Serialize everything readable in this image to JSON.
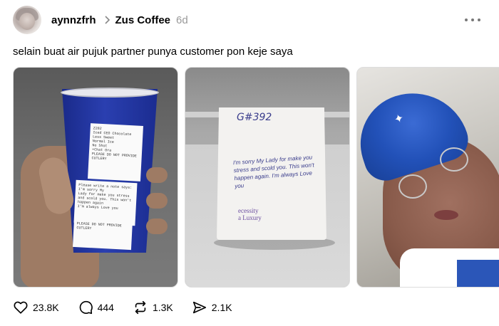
{
  "post": {
    "username": "aynnzfrh",
    "community": "Zus Coffee",
    "time_ago": "6d",
    "text": "selain buat air pujuk partner punya customer pon keje saya"
  },
  "images": {
    "cup": {
      "label1": [
        "Z282",
        "Iced CEO Chocolate",
        "Less Sweet",
        "Normal Ice",
        "No Shot",
        "+Chat Ora",
        "",
        "PLEASE DO NOT PROVIDE",
        "CUTLERY"
      ],
      "label2": [
        "Please write a note says: I'm sorry My",
        "Lady for make you stress",
        "and scold you. This won't happen again",
        "I'm always Love you"
      ],
      "label3": [
        "PLEASE DO NOT PROVIDE",
        "CUTLERY"
      ]
    },
    "bag": {
      "order_code": "G#392",
      "note": "I'm sorry My Lady for make you stress and scold you. This won't happen again. I'm always Love you",
      "brand_line1": "ecessity",
      "brand_line2": "a Luxury"
    }
  },
  "stats": {
    "likes": "23.8K",
    "replies": "444",
    "reposts": "1.3K",
    "shares": "2.1K"
  },
  "icons": [
    "chevron-right-icon",
    "more-icon",
    "heart-icon",
    "comment-icon",
    "repost-icon",
    "share-icon"
  ]
}
